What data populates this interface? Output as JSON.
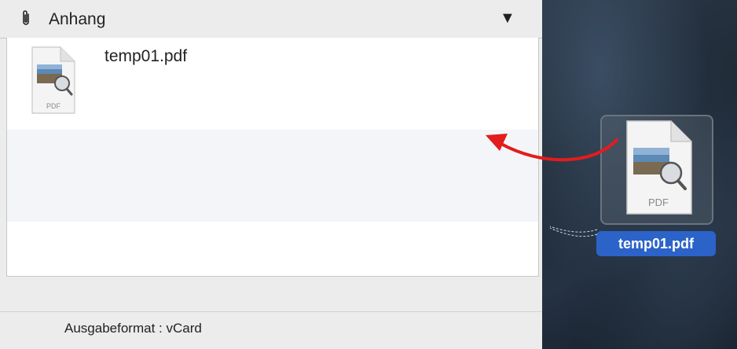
{
  "attachment_panel": {
    "title": "Anhang",
    "toggle_symbol": "▼",
    "files": [
      {
        "name": "temp01.pdf",
        "icon_text": "PDF"
      }
    ]
  },
  "footer": {
    "output_format": "Ausgabeformat : vCard"
  },
  "desktop": {
    "file": {
      "name": "temp01.pdf",
      "icon_text": "PDF"
    }
  },
  "colors": {
    "drag_arrow": "#e31c1c",
    "selection_label": "#2c63c8"
  },
  "icons": [
    "paperclip-icon",
    "pdf-file-icon",
    "drag-arrow"
  ]
}
